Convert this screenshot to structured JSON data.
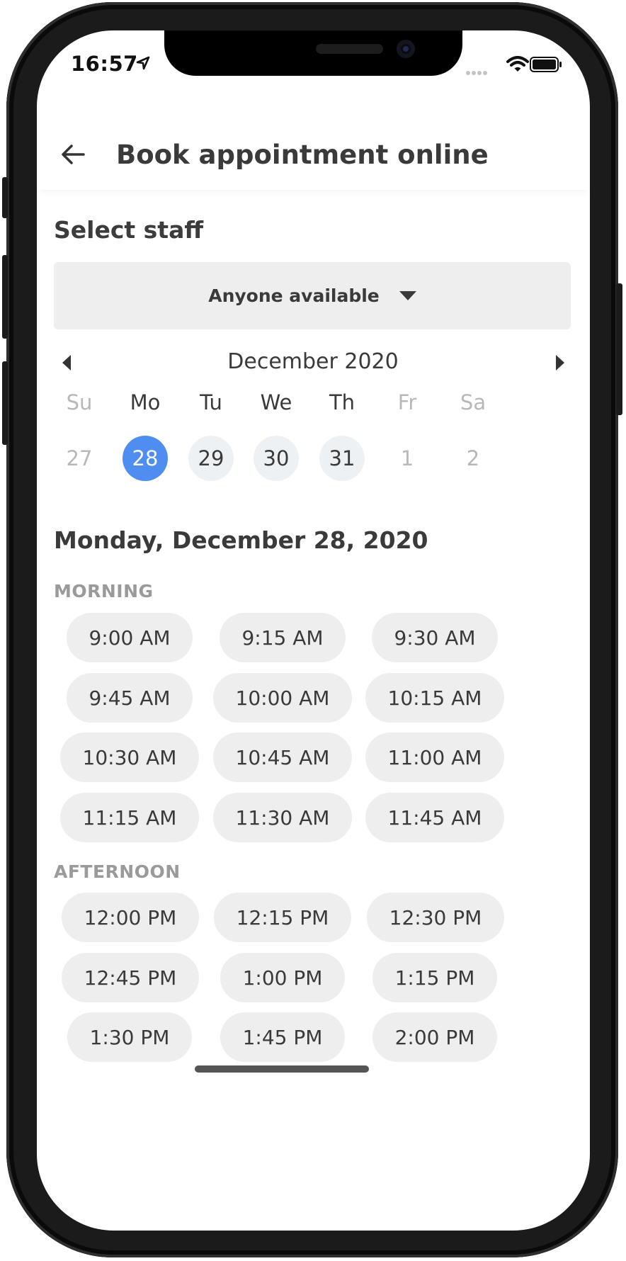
{
  "status_bar": {
    "time": "16:57"
  },
  "header": {
    "title": "Book appointment online"
  },
  "staff": {
    "section_label": "Select staff",
    "selected": "Anyone available"
  },
  "calendar": {
    "month": "December 2020",
    "weekdays": [
      "Su",
      "Mo",
      "Tu",
      "We",
      "Th",
      "Fr",
      "Sa"
    ],
    "days": [
      "27",
      "28",
      "29",
      "30",
      "31",
      "1",
      "2"
    ],
    "selected_day": "28",
    "selected_color": "#4f8ef0"
  },
  "schedule": {
    "date_heading": "Monday, December 28, 2020",
    "morning_label": "MORNING",
    "afternoon_label": "AFTERNOON",
    "morning_slots": [
      "9:00 AM",
      "9:15 AM",
      "9:30 AM",
      "9:45 AM",
      "10:00 AM",
      "10:15 AM",
      "10:30 AM",
      "10:45 AM",
      "11:00 AM",
      "11:15 AM",
      "11:30 AM",
      "11:45 AM"
    ],
    "afternoon_slots": [
      "12:00 PM",
      "12:15 PM",
      "12:30 PM",
      "12:45 PM",
      "1:00 PM",
      "1:15 PM",
      "1:30 PM",
      "1:45 PM",
      "2:00 PM"
    ]
  },
  "icons": {
    "back": "arrow-left-icon",
    "location": "location-arrow-icon",
    "wifi": "wifi-icon",
    "battery": "battery-icon",
    "signal": "cellular-signal-icon"
  }
}
